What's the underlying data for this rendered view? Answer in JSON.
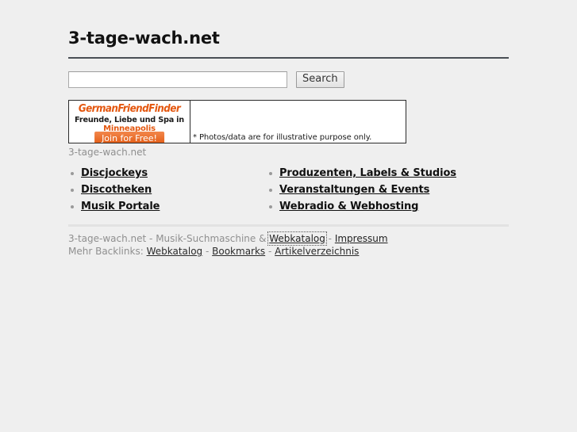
{
  "site": {
    "title": "3-tage-wach.net"
  },
  "search": {
    "value": "",
    "placeholder": "",
    "button_label": "Search"
  },
  "ad": {
    "logo": "GermanFriendFinder",
    "tagline": "Freunde, Liebe und Spa࿽ in",
    "city": "Minneapolis",
    "cta_label": "Join for Free!",
    "disclaimer": "* Photos/data are for illustrative purpose only.",
    "caption": "3-tage-wach.net"
  },
  "categories": {
    "left": [
      {
        "label": "Discjockeys"
      },
      {
        "label": "Discotheken"
      },
      {
        "label": "Musik Portale"
      }
    ],
    "right": [
      {
        "label": "Produzenten, Labels & Studios"
      },
      {
        "label": "Veranstaltungen & Events"
      },
      {
        "label": "Webradio & Webhosting"
      }
    ]
  },
  "footer": {
    "line1": {
      "text_before": "3-tage-wach.net - Musik-Suchmaschine & ",
      "link_webkatalog": "Webkatalog",
      "sep1": " - ",
      "link_impressum": "Impressum"
    },
    "line2": {
      "label": "Mehr Backlinks: ",
      "link_webkatalog": "Webkatalog",
      "sep1": " - ",
      "link_bookmarks": "Bookmarks",
      "sep2": " - ",
      "link_artikelverzeichnis": "Artikelverzeichnis"
    }
  },
  "colors": {
    "background": "#efefef",
    "accent_orange": "#e4570f",
    "rule_dark": "#4a4f55",
    "muted_text": "#8f8f8f"
  }
}
